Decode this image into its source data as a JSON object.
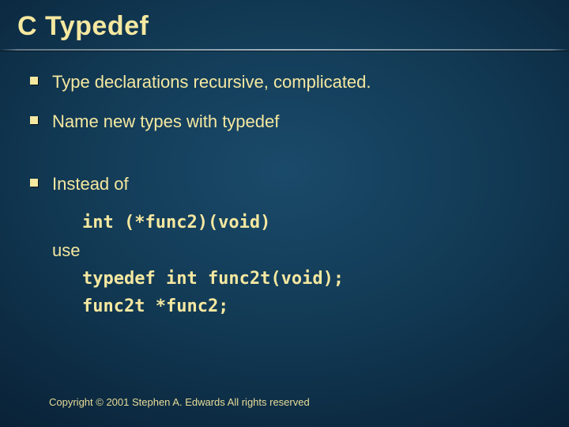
{
  "title": "C Typedef",
  "bullets": {
    "b1": "Type declarations recursive, complicated.",
    "b2": "Name new types with typedef",
    "b3": "Instead of"
  },
  "code": {
    "line1": "int (*func2)(void)",
    "useLabel": "use",
    "line2": "typedef int func2t(void);",
    "line3": "func2t *func2;"
  },
  "copyright": "Copyright © 2001 Stephen A. Edwards  All rights reserved"
}
